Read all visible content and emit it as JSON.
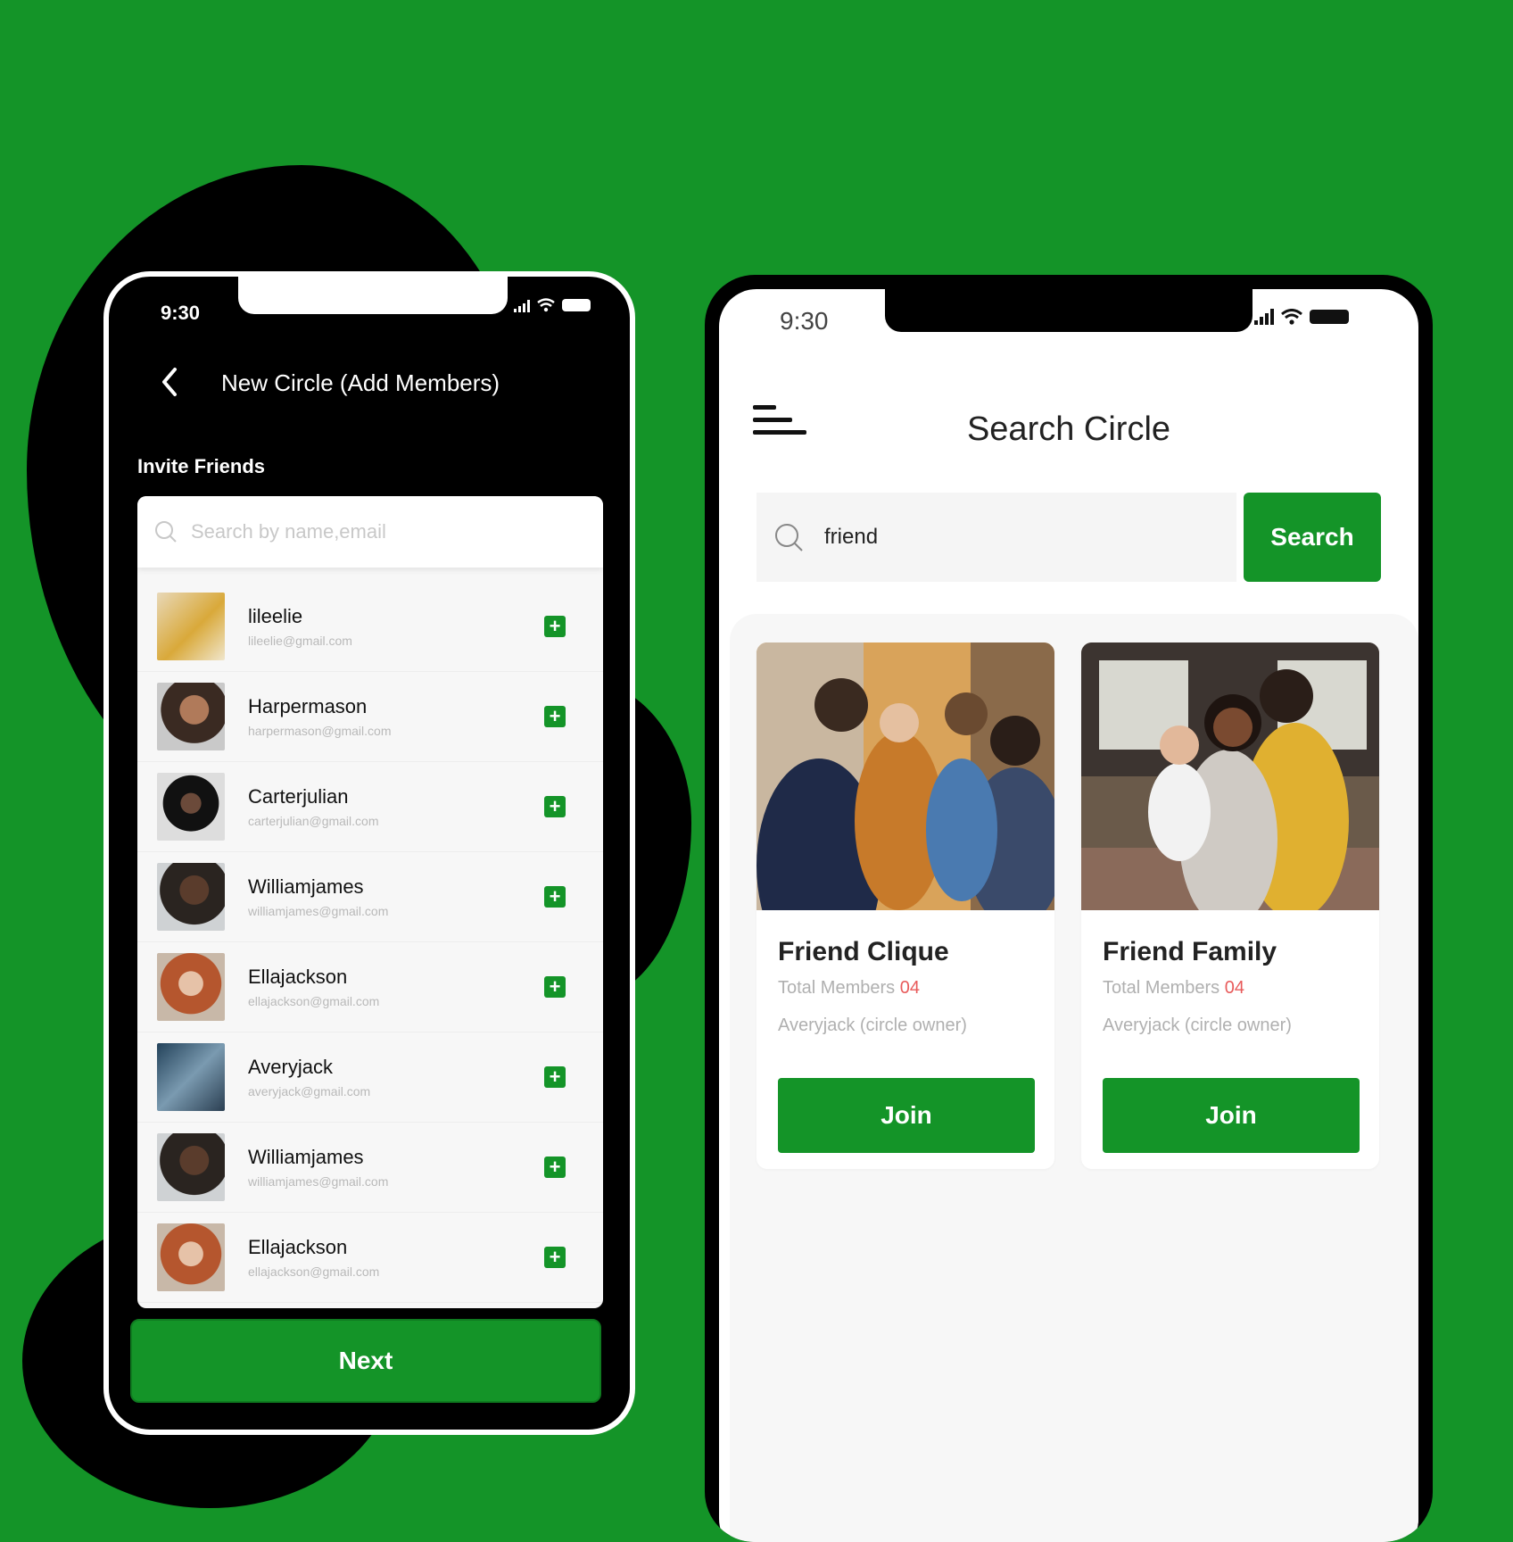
{
  "colors": {
    "accent": "#149428",
    "background": "#149428",
    "member_count": "#e85b5b"
  },
  "phone1": {
    "status_time": "9:30",
    "title": "New Circle (Add Members)",
    "section_label": "Invite Friends",
    "search_placeholder": "Search by name,email",
    "members": [
      {
        "name": "lileelie",
        "email": "lileelie@gmail.com"
      },
      {
        "name": "Harpermason",
        "email": "harpermason@gmail.com"
      },
      {
        "name": "Carterjulian",
        "email": "carterjulian@gmail.com"
      },
      {
        "name": "Williamjames",
        "email": "williamjames@gmail.com"
      },
      {
        "name": "Ellajackson",
        "email": "ellajackson@gmail.com"
      },
      {
        "name": "Averyjack",
        "email": "averyjack@gmail.com"
      },
      {
        "name": "Williamjames",
        "email": "williamjames@gmail.com"
      },
      {
        "name": "Ellajackson",
        "email": "ellajackson@gmail.com"
      }
    ],
    "next_label": "Next"
  },
  "phone2": {
    "status_time": "9:30",
    "title": "Search Circle",
    "search_value": "friend",
    "search_button": "Search",
    "circles": [
      {
        "title": "Friend Clique",
        "members_label": "Total Members",
        "members_count": "04",
        "owner": "Averyjack (circle owner)",
        "join_label": "Join"
      },
      {
        "title": "Friend Family",
        "members_label": "Total Members",
        "members_count": "04",
        "owner": "Averyjack (circle owner)",
        "join_label": "Join"
      }
    ]
  }
}
